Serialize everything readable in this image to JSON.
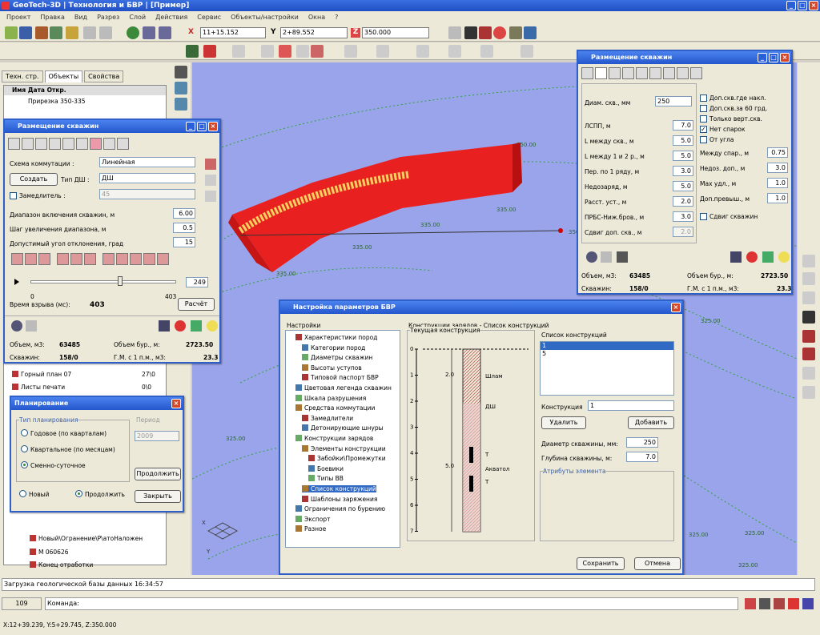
{
  "title": "GeoTech-3D  |  Технология и БВР  |  [Пример]",
  "menu": [
    "Проект",
    "Правка",
    "Вид",
    "Разрез",
    "Слой",
    "Действия",
    "Сервис",
    "Объекты/настройки",
    "Окна",
    "?"
  ],
  "coords": {
    "x_label": "X",
    "x": "11+15.152",
    "y_label": "Y",
    "y": "2+89.552",
    "z_label": "Z",
    "z": "350.000"
  },
  "left_panel": {
    "tabs": [
      "Техн. стр.",
      "Объекты",
      "Свойства"
    ],
    "cols": "Имя  Дата  Откр.",
    "row1": "Прирезка 350-335",
    "tree_items": [
      {
        "name": "Горный план 07",
        "v": "27\\0"
      },
      {
        "name": "Листы печати",
        "v": "0\\0"
      }
    ],
    "tree_bottom": [
      "Новый\\Огранение\\Р\\атоНаложен",
      "М 060626",
      "Конец отработки"
    ]
  },
  "win_left": {
    "title": "Размещение скважин",
    "schema_label": "Схема коммутации :",
    "schema_val": "Линейная",
    "create": "Создать",
    "type_label": "Тип ДШ :",
    "type_val": "ДШ",
    "delay_label": "Замедлитель :",
    "delay_val": "45",
    "params": [
      {
        "l": "Диапазон включения скважин, м",
        "v": "6.00"
      },
      {
        "l": "Шаг увеличения диапазона, м",
        "v": "0.5"
      },
      {
        "l": "Допустимый угол отклонения, град",
        "v": "15"
      }
    ],
    "slider_min": "0",
    "slider_max": "403",
    "slider_val": "249",
    "time_label": "Время взрыва (мс):",
    "time_val": "403",
    "calc": "Расчёт",
    "vol_label": "Объем, м3:",
    "vol_val": "63485",
    "bur_label": "Объем бур., м:",
    "bur_val": "2723.50",
    "wells_label": "Скважин:",
    "wells_val": "158/0",
    "gm_label": "Г.М. с 1 п.м., м3:",
    "gm_val": "23.3"
  },
  "win_right": {
    "title": "Размещение скважин",
    "diam_label": "Диам. скв., мм",
    "diam_val": "250",
    "rows": [
      {
        "l": "ЛСПП, м",
        "v": "7.0"
      },
      {
        "l": "L между скв., м",
        "v": "5.0"
      },
      {
        "l": "L между 1 и 2 р., м",
        "v": "5.0"
      },
      {
        "l": "Пер. по 1 ряду, м",
        "v": "3.0"
      },
      {
        "l": "Недозаряд, м",
        "v": "5.0"
      },
      {
        "l": "Расст. уст., м",
        "v": "2.0"
      },
      {
        "l": "ПРБС-Ниж.бров., м",
        "v": "3.0"
      },
      {
        "l": "Сдвиг доп. скв., м",
        "v": "2.0"
      }
    ],
    "checks": [
      {
        "l": "Доп.скв.где накл.",
        "on": false
      },
      {
        "l": "Доп.скв.за 60 грд.",
        "on": false
      },
      {
        "l": "Только верт.скв.",
        "on": false
      },
      {
        "l": "Нет спарок",
        "on": true
      },
      {
        "l": "От угла",
        "on": false
      }
    ],
    "rrows": [
      {
        "l": "Между спар., м",
        "v": "0.75"
      },
      {
        "l": "Недоз. доп., м",
        "v": "3.0"
      },
      {
        "l": "Max удл., м",
        "v": "1.0"
      },
      {
        "l": "Доп.превыш., м",
        "v": "1.0"
      }
    ],
    "shift": "Сдвиг скважин",
    "vol_label": "Объем, м3:",
    "vol_val": "63485",
    "bur_label": "Объем бур., м:",
    "bur_val": "2723.50",
    "wells_label": "Скважин:",
    "wells_val": "158/0",
    "gm_label": "Г.М. с 1 п.м., м3:",
    "gm_val": "23.3"
  },
  "win_plan": {
    "title": "Планирование",
    "group": "Тип планирования",
    "period": "Период",
    "period_val": "2009",
    "opts": [
      "Годовое (по кварталам)",
      "Квартальное (по месяцам)",
      "Сменно-суточное"
    ],
    "sel": 2,
    "continue_btn": "Продолжить",
    "new_opt": "Новый",
    "cont_opt": "Продолжить",
    "close": "Закрыть"
  },
  "win_bvr": {
    "title": "Настройка параметров БВР",
    "settings": "Настройки",
    "heading": "Конструкции зарядов - Список конструкций",
    "tree": [
      "Характеристики пород",
      "Категории пород",
      "Диаметры скважин",
      "Высоты уступов",
      "Типовой паспорт БВР",
      "Цветовая легенда скважин",
      "Шкала разрушения",
      "Средства коммутации",
      "Замедлители",
      "Детонирующие шнуры",
      "Конструкции зарядов",
      "Элементы конструкции",
      "Забойки\\Промежутки",
      "Боевики",
      "Типы ВВ",
      "Список конструкций",
      "Шаблоны заряжения",
      "Ограничения по бурению",
      "Экспорт",
      "Разное"
    ],
    "current": "Текущая конструкция",
    "list_label": "Список конструкций",
    "list": [
      "1",
      "5"
    ],
    "constr_label": "Конструкция",
    "constr_val": "1",
    "del": "Удалить",
    "add": "Добавить",
    "diam_label": "Диаметр скважины, мм:",
    "diam_val": "250",
    "depth_label": "Глубина скважины, м:",
    "depth_val": "7.0",
    "attrs": "Атрибуты элемента",
    "save": "Сохранить",
    "cancel": "Отмена",
    "scale": [
      "0",
      "1",
      "2",
      "3",
      "4",
      "5",
      "6",
      "7"
    ],
    "dims": [
      "2.0",
      "5.0"
    ],
    "tags": [
      "Шлам",
      "ДШ",
      "Т",
      "Т",
      "Акватол"
    ]
  },
  "viewport": {
    "levels": [
      "350.00",
      "335.00",
      "335.00",
      "335.00",
      "335.00",
      "335.00",
      "325.00",
      "325.00",
      "325.00",
      "325.00",
      "325.00",
      "350.00"
    ]
  },
  "status": {
    "log": "Загрузка геологической базы данных 16:34:57",
    "num": "109",
    "cmd": "Команда:",
    "coords": "X:12+39.239, Y:5+29.745, Z:350.000"
  }
}
